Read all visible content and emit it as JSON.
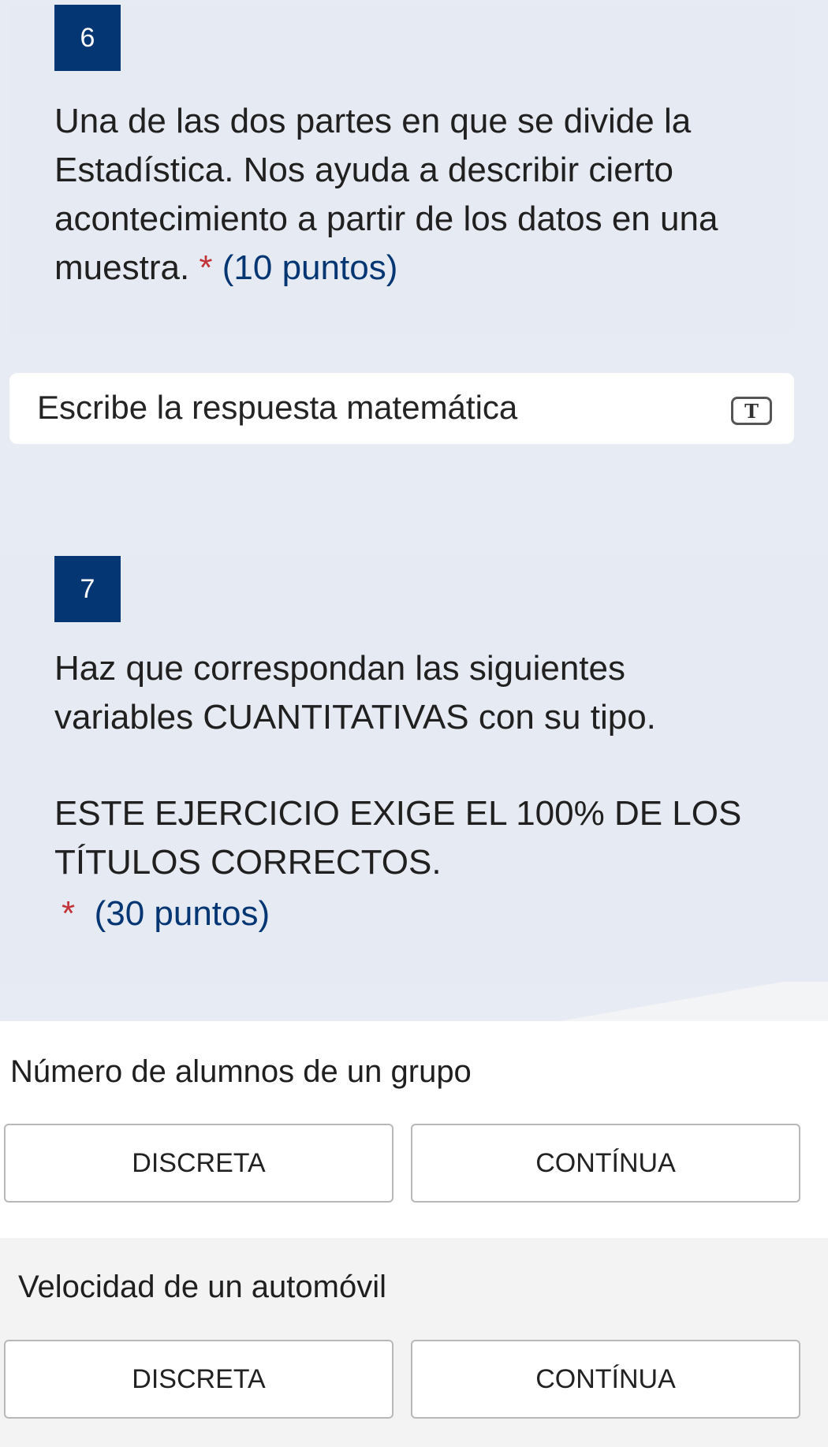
{
  "questions": [
    {
      "number": "6",
      "text": "Una de las dos partes en que se divide la Estadística. Nos ayuda a describir cierto acontecimiento a partir de los datos en una muestra.",
      "required_mark": "*",
      "points": "(10 puntos)",
      "answer_placeholder": "Escribe la respuesta matemática",
      "answer_icon": "T"
    },
    {
      "number": "7",
      "text_line1": "Haz que correspondan las siguientes variables CUANTITATIVAS con su tipo.",
      "text_line2": "ESTE EJERCICIO EXIGE EL 100% DE LOS TÍTULOS CORRECTOS.",
      "required_mark": "*",
      "points": "(30 puntos)",
      "rows": [
        {
          "label": "Número de alumnos de un grupo",
          "options": [
            "DISCRETA",
            "CONTÍNUA"
          ]
        },
        {
          "label": "Velocidad de un automóvil",
          "options": [
            "DISCRETA",
            "CONTÍNUA"
          ]
        }
      ]
    }
  ],
  "colors": {
    "number_badge": "#033673",
    "points": "#033673",
    "required": "#c23337",
    "question_bg": "#e6eaf2"
  }
}
